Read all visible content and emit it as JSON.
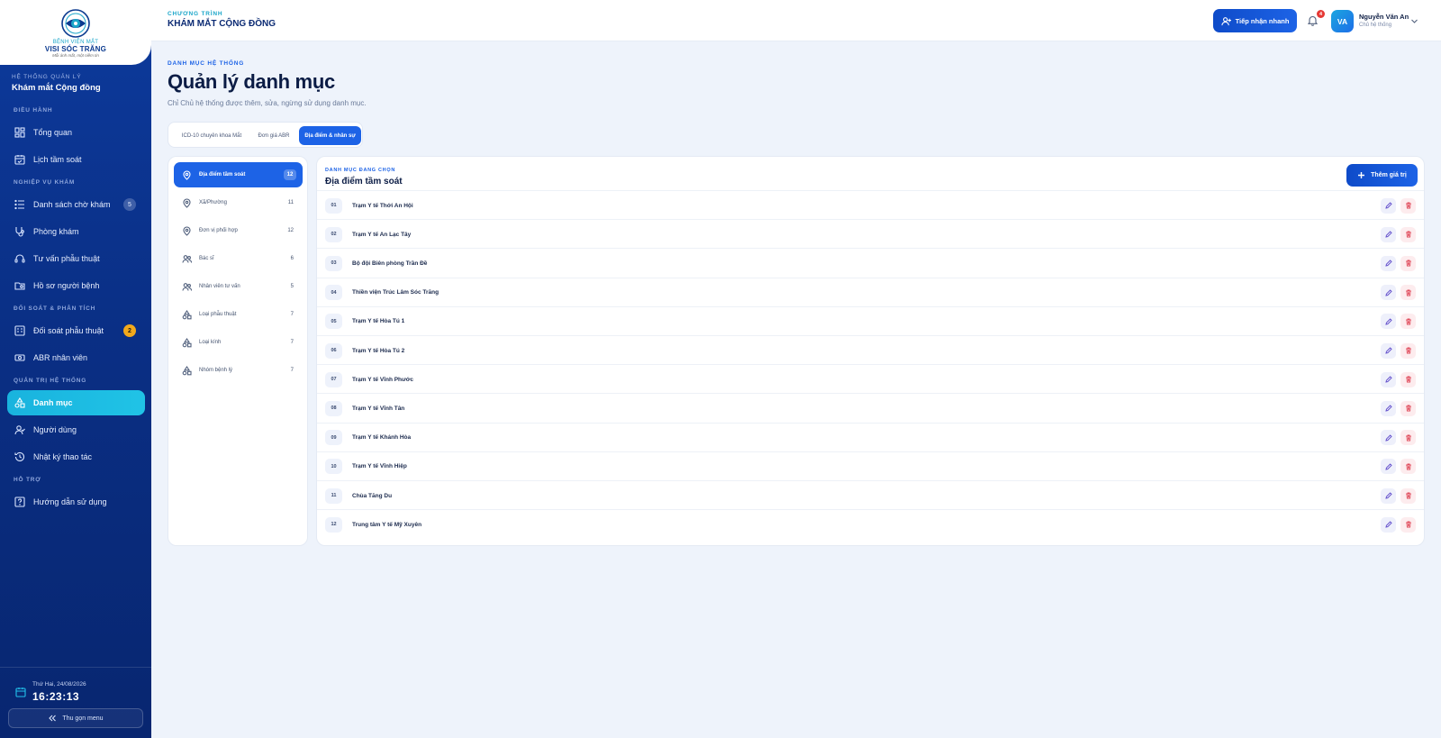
{
  "sidebar": {
    "logo": {
      "line1": "BỆNH VIỆN MẮT",
      "line2": "VISI SÓC TRĂNG",
      "line3": "Mỗi ánh mắt, một niềm tin"
    },
    "system_label": "HỆ THỐNG QUẢN LÝ",
    "system_name": "Khám mắt Cộng đồng",
    "sections": [
      {
        "label": "ĐIỀU HÀNH",
        "items": [
          {
            "label": "Tổng quan",
            "icon": "dashboard-icon"
          },
          {
            "label": "Lịch tầm soát",
            "icon": "calendar-icon"
          }
        ]
      },
      {
        "label": "NGHIỆP VỤ KHÁM",
        "items": [
          {
            "label": "Danh sách chờ khám",
            "icon": "list-icon",
            "badge": "5"
          },
          {
            "label": "Phòng khám",
            "icon": "stethoscope-icon"
          },
          {
            "label": "Tư vấn phẫu thuật",
            "icon": "headset-icon"
          },
          {
            "label": "Hồ sơ người bệnh",
            "icon": "folder-icon"
          }
        ]
      },
      {
        "label": "ĐỐI SOÁT & PHÂN TÍCH",
        "items": [
          {
            "label": "Đối soát phẫu thuật",
            "icon": "checklist-icon",
            "badge": "2"
          },
          {
            "label": "ABR nhân viên",
            "icon": "money-icon"
          }
        ]
      },
      {
        "label": "QUẢN TRỊ HỆ THỐNG",
        "items": [
          {
            "label": "Danh mục",
            "icon": "category-icon",
            "active": true
          },
          {
            "label": "Người dùng",
            "icon": "users-icon"
          },
          {
            "label": "Nhật ký thao tác",
            "icon": "history-icon"
          }
        ]
      },
      {
        "label": "HỖ TRỢ",
        "items": [
          {
            "label": "Hướng dẫn sử dụng",
            "icon": "help-icon"
          }
        ]
      }
    ],
    "clock": {
      "date": "Thứ Hai, 24/08/2026",
      "time": "16:23:13"
    },
    "collapse_label": "Thu gọn menu"
  },
  "header": {
    "program_label": "CHƯƠNG TRÌNH",
    "program_name": "KHÁM MẮT CỘNG ĐỒNG",
    "quick_button": "Tiếp nhận nhanh",
    "notification_count": "4",
    "user": {
      "initials": "VA",
      "name": "Nguyễn Văn An",
      "role": "Chủ hệ thống"
    }
  },
  "page": {
    "eyebrow": "DANH MỤC HỆ THỐNG",
    "title": "Quản lý danh mục",
    "subtitle": "Chỉ Chủ hệ thống được thêm, sửa, ngừng sử dụng danh mục.",
    "tabs": [
      {
        "label": "ICD-10 chuyên khoa Mắt"
      },
      {
        "label": "Đơn giá ABR"
      },
      {
        "label": "Địa điểm & nhân sự",
        "active": true
      }
    ]
  },
  "categories": [
    {
      "label": "Địa điểm tầm soát",
      "count": "12",
      "icon": "location-pin-icon",
      "active": true
    },
    {
      "label": "Xã/Phường",
      "count": "11",
      "icon": "location-pin-icon"
    },
    {
      "label": "Đơn vị phối hợp",
      "count": "12",
      "icon": "location-pin-icon"
    },
    {
      "label": "Bác sĩ",
      "count": "6",
      "icon": "users-icon"
    },
    {
      "label": "Nhân viên tư vấn",
      "count": "5",
      "icon": "users-icon"
    },
    {
      "label": "Loại phẫu thuật",
      "count": "7",
      "icon": "shapes-icon"
    },
    {
      "label": "Loại kính",
      "count": "7",
      "icon": "shapes-icon"
    },
    {
      "label": "Nhóm bệnh lý",
      "count": "7",
      "icon": "shapes-icon"
    }
  ],
  "list": {
    "eyebrow": "DANH MỤC ĐANG CHỌN",
    "title": "Địa điểm tầm soát",
    "add_button": "Thêm giá trị",
    "rows": [
      {
        "num": "01",
        "name": "Trạm Y tế Thới An Hội"
      },
      {
        "num": "02",
        "name": "Trạm Y tế An Lạc Tây"
      },
      {
        "num": "03",
        "name": "Bộ đội Biên phòng Trần Đề"
      },
      {
        "num": "04",
        "name": "Thiền viện Trúc Lâm Sóc Trăng"
      },
      {
        "num": "05",
        "name": "Trạm Y tế Hòa Tú 1"
      },
      {
        "num": "06",
        "name": "Trạm Y tế Hòa Tú 2"
      },
      {
        "num": "07",
        "name": "Trạm Y tế Vĩnh Phước"
      },
      {
        "num": "08",
        "name": "Trạm Y tế Vĩnh Tân"
      },
      {
        "num": "09",
        "name": "Trạm Y tế Khánh Hòa"
      },
      {
        "num": "10",
        "name": "Trạm Y tế Vĩnh Hiệp"
      },
      {
        "num": "11",
        "name": "Chùa Tăng Du"
      },
      {
        "num": "12",
        "name": "Trung tâm Y tế Mỹ Xuyên"
      }
    ]
  },
  "colors": {
    "primary": "#1d63e6",
    "sidebar": "#0b338f",
    "accent": "#19b3de",
    "warning": "#f2a91c",
    "danger": "#e53935"
  }
}
